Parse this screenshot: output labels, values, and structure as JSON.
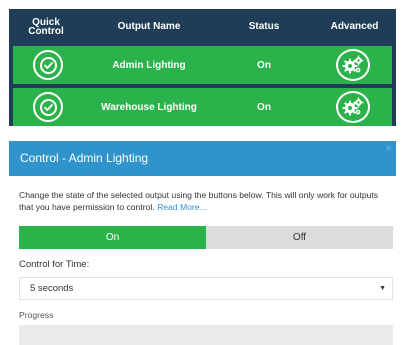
{
  "outputs_table": {
    "headers": {
      "quick_control_line1": "Quick",
      "quick_control_line2": "Control",
      "output_name": "Output Name",
      "status": "Status",
      "advanced": "Advanced"
    },
    "rows": [
      {
        "name": "Admin Lighting",
        "status": "On"
      },
      {
        "name": "Warehouse Lighting",
        "status": "On"
      }
    ],
    "icons": {
      "quick_control": "check-circle-icon",
      "advanced": "gears-icon"
    }
  },
  "modal": {
    "title": "Control - Admin Lighting",
    "close_glyph": "×",
    "description": "Change the state of the selected output using the buttons below. This will only work for outputs that you have permission to control.",
    "read_more": "Read More...",
    "toggle": {
      "on_label": "On",
      "off_label": "Off",
      "selected": "On"
    },
    "time_label": "Control for Time:",
    "time_value": "5 seconds",
    "select_arrow": "▼",
    "progress_label": "Progress",
    "progress_fraction": 0
  },
  "colors": {
    "table_bg": "#1f3d57",
    "row_green": "#2cb24a",
    "modal_header": "#2f94cc",
    "link": "#2f8fd1",
    "off_gray": "#dcdcdc"
  }
}
